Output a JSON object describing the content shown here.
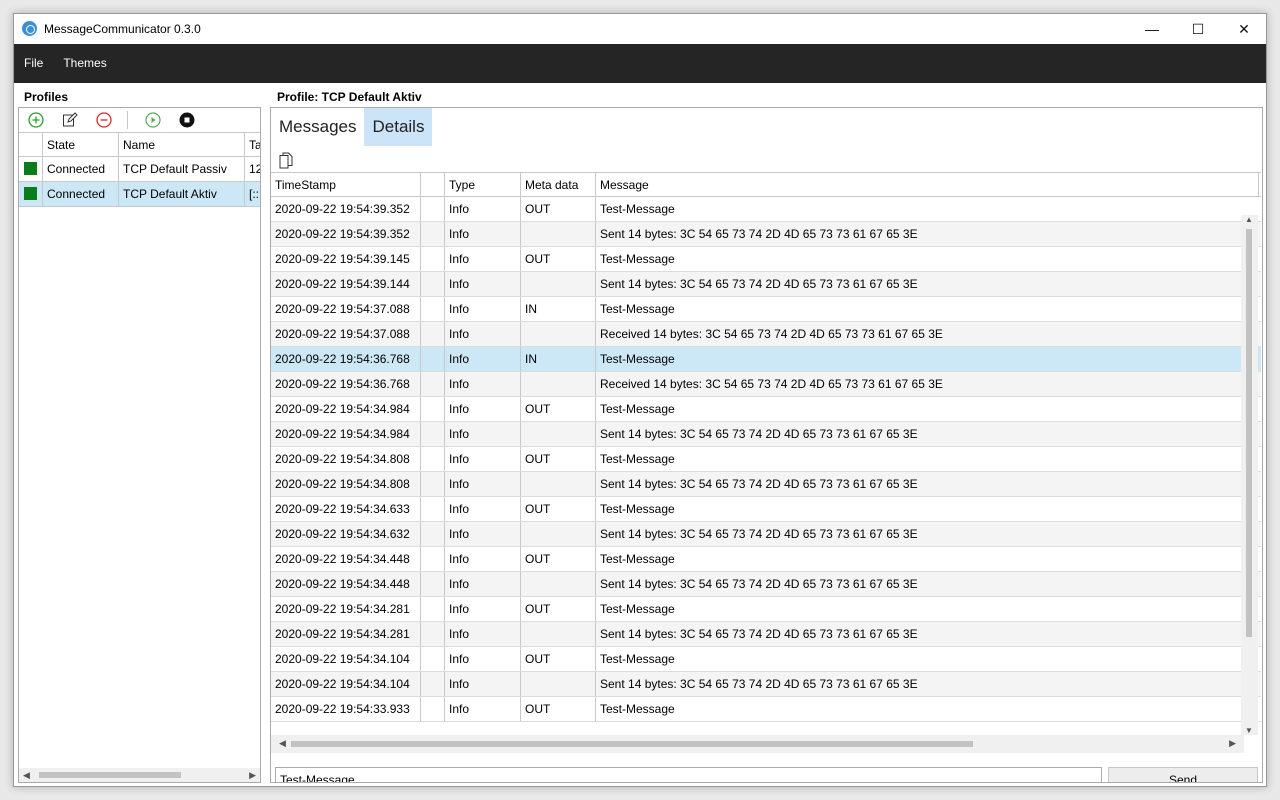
{
  "window": {
    "title": "MessageCommunicator 0.3.0",
    "min_glyph": "—",
    "max_glyph": "☐",
    "close_glyph": "✕"
  },
  "menu": [
    "File",
    "Themes"
  ],
  "profiles": {
    "title": "Profiles",
    "columns": [
      "",
      "State",
      "Name",
      "Ta"
    ],
    "rows": [
      {
        "state": "Connected",
        "name": "TCP Default Passiv",
        "target": "12",
        "state_color": "#0a7d1a",
        "selected": false
      },
      {
        "state": "Connected",
        "name": "TCP Default Aktiv",
        "target": "[::",
        "state_color": "#0a7d1a",
        "selected": true
      }
    ]
  },
  "profile_detail": {
    "title": "Profile: TCP Default Aktiv",
    "tabs": [
      {
        "label": "Messages",
        "active": false
      },
      {
        "label": "Details",
        "active": true
      }
    ],
    "columns": [
      "TimeStamp",
      "",
      "Type",
      "Meta data",
      "Message"
    ],
    "rows": [
      {
        "ts": "2020-09-22 19:54:39.352",
        "type": "Info",
        "meta": "OUT",
        "msg": "Test-Message"
      },
      {
        "ts": "2020-09-22 19:54:39.352",
        "type": "Info",
        "meta": "",
        "msg": "Sent 14 bytes: 3C 54 65 73 74 2D 4D 65 73 73 61 67 65 3E"
      },
      {
        "ts": "2020-09-22 19:54:39.145",
        "type": "Info",
        "meta": "OUT",
        "msg": "Test-Message"
      },
      {
        "ts": "2020-09-22 19:54:39.144",
        "type": "Info",
        "meta": "",
        "msg": "Sent 14 bytes: 3C 54 65 73 74 2D 4D 65 73 73 61 67 65 3E"
      },
      {
        "ts": "2020-09-22 19:54:37.088",
        "type": "Info",
        "meta": "IN",
        "msg": "Test-Message"
      },
      {
        "ts": "2020-09-22 19:54:37.088",
        "type": "Info",
        "meta": "",
        "msg": "Received 14 bytes: 3C 54 65 73 74 2D 4D 65 73 73 61 67 65 3E"
      },
      {
        "ts": "2020-09-22 19:54:36.768",
        "type": "Info",
        "meta": "IN",
        "msg": "Test-Message"
      },
      {
        "ts": "2020-09-22 19:54:36.768",
        "type": "Info",
        "meta": "",
        "msg": "Received 14 bytes: 3C 54 65 73 74 2D 4D 65 73 73 61 67 65 3E"
      },
      {
        "ts": "2020-09-22 19:54:34.984",
        "type": "Info",
        "meta": "OUT",
        "msg": "Test-Message"
      },
      {
        "ts": "2020-09-22 19:54:34.984",
        "type": "Info",
        "meta": "",
        "msg": "Sent 14 bytes: 3C 54 65 73 74 2D 4D 65 73 73 61 67 65 3E"
      },
      {
        "ts": "2020-09-22 19:54:34.808",
        "type": "Info",
        "meta": "OUT",
        "msg": "Test-Message"
      },
      {
        "ts": "2020-09-22 19:54:34.808",
        "type": "Info",
        "meta": "",
        "msg": "Sent 14 bytes: 3C 54 65 73 74 2D 4D 65 73 73 61 67 65 3E"
      },
      {
        "ts": "2020-09-22 19:54:34.633",
        "type": "Info",
        "meta": "OUT",
        "msg": "Test-Message"
      },
      {
        "ts": "2020-09-22 19:54:34.632",
        "type": "Info",
        "meta": "",
        "msg": "Sent 14 bytes: 3C 54 65 73 74 2D 4D 65 73 73 61 67 65 3E"
      },
      {
        "ts": "2020-09-22 19:54:34.448",
        "type": "Info",
        "meta": "OUT",
        "msg": "Test-Message"
      },
      {
        "ts": "2020-09-22 19:54:34.448",
        "type": "Info",
        "meta": "",
        "msg": "Sent 14 bytes: 3C 54 65 73 74 2D 4D 65 73 73 61 67 65 3E"
      },
      {
        "ts": "2020-09-22 19:54:34.281",
        "type": "Info",
        "meta": "OUT",
        "msg": "Test-Message"
      },
      {
        "ts": "2020-09-22 19:54:34.281",
        "type": "Info",
        "meta": "",
        "msg": "Sent 14 bytes: 3C 54 65 73 74 2D 4D 65 73 73 61 67 65 3E"
      },
      {
        "ts": "2020-09-22 19:54:34.104",
        "type": "Info",
        "meta": "OUT",
        "msg": "Test-Message"
      },
      {
        "ts": "2020-09-22 19:54:34.104",
        "type": "Info",
        "meta": "",
        "msg": "Sent 14 bytes: 3C 54 65 73 74 2D 4D 65 73 73 61 67 65 3E"
      },
      {
        "ts": "2020-09-22 19:54:33.933",
        "type": "Info",
        "meta": "OUT",
        "msg": "Test-Message"
      }
    ],
    "selected_row_index": 6
  },
  "compose": {
    "value": "Test-Message",
    "send_label": "Send"
  },
  "colors": {
    "menubar_bg": "#252525",
    "selection": "#cce8f6",
    "connected": "#0a7d1a",
    "add": "#2a9d2a",
    "remove": "#d62b2b",
    "start": "#5aaa5a"
  },
  "icons": [
    "add-icon",
    "edit-icon",
    "remove-icon",
    "start-icon",
    "stop-icon",
    "copy-icon"
  ]
}
